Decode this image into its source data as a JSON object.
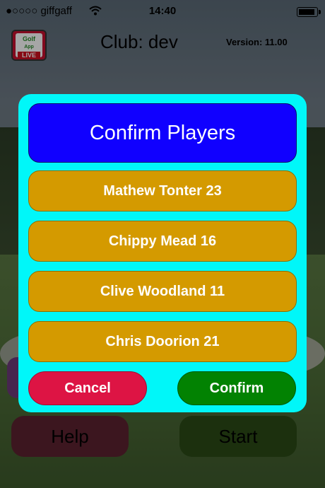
{
  "status_bar": {
    "carrier": "●○○○○ giffgaff",
    "wifi_icon": "wifi-icon",
    "time": "14:40",
    "battery_icon": "battery-icon"
  },
  "header": {
    "logo_text_top": "Golf",
    "logo_text_mid": "App",
    "logo_text_bottom": "LIVE",
    "club_title": "Club: dev",
    "version": "Version: 11.00"
  },
  "background_buttons": {
    "help": "Help",
    "start": "Start"
  },
  "dialog": {
    "title": "Confirm Players",
    "players": [
      "Mathew Tonter 23",
      "Chippy Mead 16",
      "Clive Woodland 11",
      "Chris Doorion 21"
    ],
    "cancel_label": "Cancel",
    "confirm_label": "Confirm"
  },
  "colors": {
    "dialog_bg": "#00f7f9",
    "title_bg": "#1000ff",
    "player_bg": "#d49a00",
    "cancel_bg": "#dd1444",
    "confirm_bg": "#028202"
  }
}
